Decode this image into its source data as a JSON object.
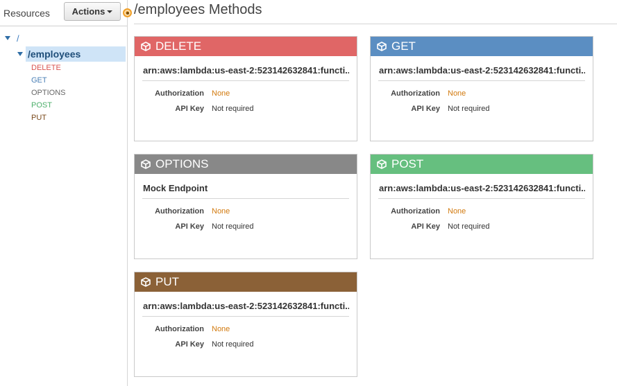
{
  "sidebar": {
    "title": "Resources",
    "actions_label": "Actions",
    "root_label": "/",
    "resource_label": "/employees",
    "methods": [
      {
        "label": "DELETE",
        "color": "#d9534f"
      },
      {
        "label": "GET",
        "color": "#4a7fb5"
      },
      {
        "label": "OPTIONS",
        "color": "#666666"
      },
      {
        "label": "POST",
        "color": "#4caf6a"
      },
      {
        "label": "PUT",
        "color": "#7a4a1c"
      }
    ]
  },
  "main": {
    "title": "/employees Methods",
    "cards": [
      {
        "method": "DELETE",
        "color": "#e06666",
        "target": "arn:aws:lambda:us-east-2:523142632841:functi...",
        "auth_label": "Authorization",
        "auth_value": "None",
        "apikey_label": "API Key",
        "apikey_value": "Not required"
      },
      {
        "method": "GET",
        "color": "#5b8ec2",
        "target": "arn:aws:lambda:us-east-2:523142632841:functi...",
        "auth_label": "Authorization",
        "auth_value": "None",
        "apikey_label": "API Key",
        "apikey_value": "Not required"
      },
      {
        "method": "OPTIONS",
        "color": "#888888",
        "target": "Mock Endpoint",
        "auth_label": "Authorization",
        "auth_value": "None",
        "apikey_label": "API Key",
        "apikey_value": "Not required"
      },
      {
        "method": "POST",
        "color": "#66bf7f",
        "target": "arn:aws:lambda:us-east-2:523142632841:functi...",
        "auth_label": "Authorization",
        "auth_value": "None",
        "apikey_label": "API Key",
        "apikey_value": "Not required"
      },
      {
        "method": "PUT",
        "color": "#8b6137",
        "target": "arn:aws:lambda:us-east-2:523142632841:functi...",
        "auth_label": "Authorization",
        "auth_value": "None",
        "apikey_label": "API Key",
        "apikey_value": "Not required"
      }
    ]
  }
}
